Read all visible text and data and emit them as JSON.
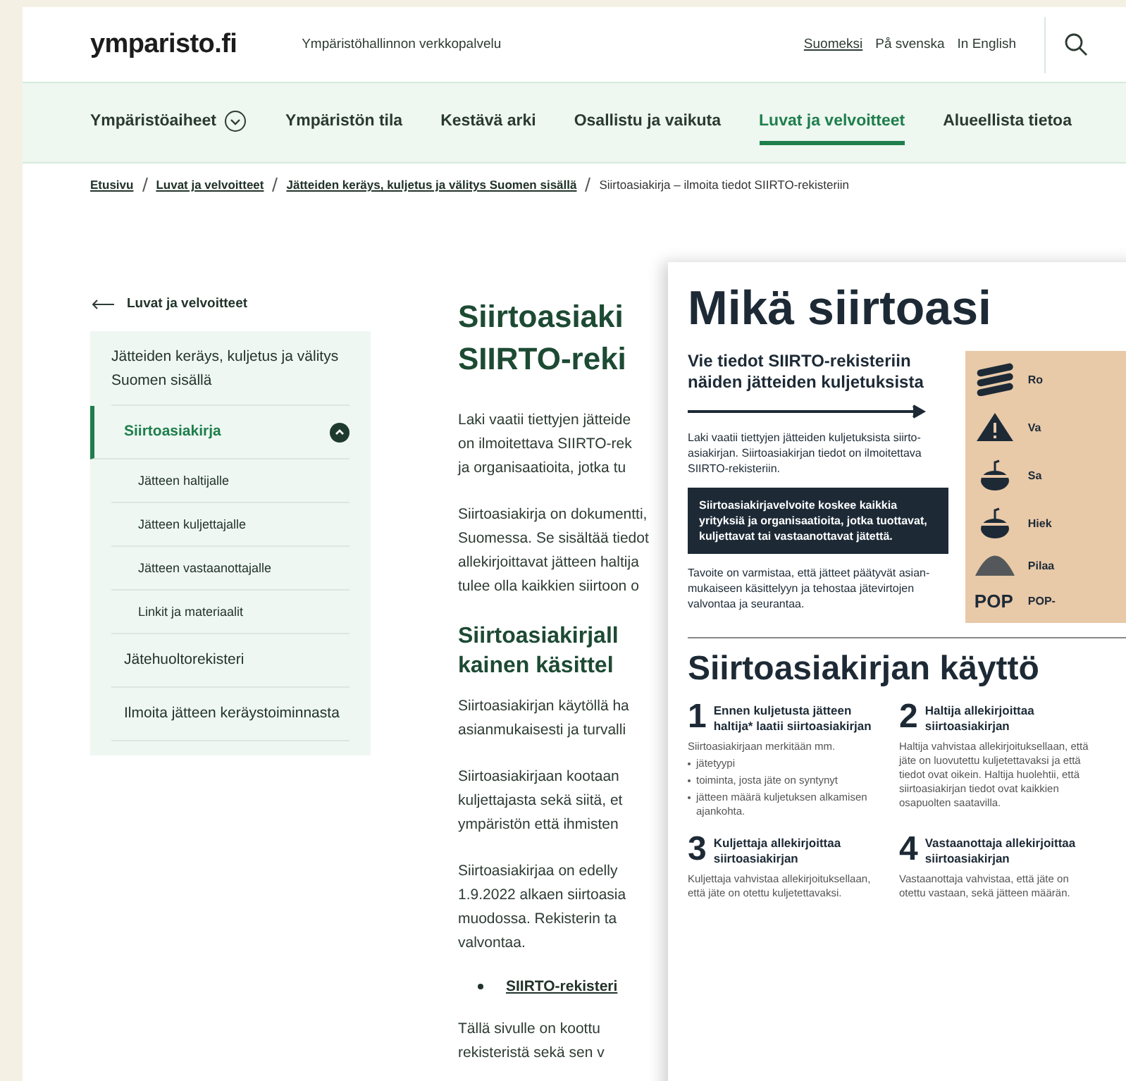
{
  "header": {
    "logo": "ymparisto.fi",
    "tagline": "Ympäristöhallinnon verkkopalvelu",
    "languages": [
      {
        "label": "Suomeksi",
        "selected": true
      },
      {
        "label": "På svenska",
        "selected": false
      },
      {
        "label": "In English",
        "selected": false
      }
    ]
  },
  "nav": [
    {
      "label": "Ympäristöaiheet",
      "selected": false,
      "kind": "dropdown"
    },
    {
      "label": "Ympäristön tila",
      "selected": false,
      "kind": "link"
    },
    {
      "label": "Kestävä arki",
      "selected": false,
      "kind": "link"
    },
    {
      "label": "Osallistu ja vaikuta",
      "selected": false,
      "kind": "link"
    },
    {
      "label": "Luvat ja velvoitteet",
      "selected": true,
      "kind": "link"
    },
    {
      "label": "Alueellista tietoa",
      "selected": false,
      "kind": "link"
    }
  ],
  "breadcrumb": [
    {
      "label": "Etusivu",
      "kind": "link"
    },
    {
      "label": "Luvat ja velvoitteet",
      "kind": "link"
    },
    {
      "label": "Jätteiden keräys, kuljetus ja välitys Suomen sisällä",
      "kind": "link"
    },
    {
      "label": "Siirtoasiakirja – ilmoita tiedot SIIRTO-rekisteriin",
      "kind": "current"
    }
  ],
  "sidebar": {
    "back_link": "Luvat ja velvoitteet",
    "section_title": "Jätteiden keräys, kuljetus ja välitys Suomen sisällä",
    "items": [
      {
        "label": "Siirtoasiakirja",
        "selected": true,
        "expanded": true,
        "children": [
          {
            "label": "Jätteen haltijalle",
            "selected": false
          },
          {
            "label": "Jätteen kuljettajalle",
            "selected": false
          },
          {
            "label": "Jätteen vastaanottajalle",
            "selected": false
          },
          {
            "label": "Linkit ja materiaalit",
            "selected": false
          }
        ]
      },
      {
        "label": "Jätehuoltorekisteri",
        "selected": false
      },
      {
        "label": "Ilmoita jätteen keräystoiminnasta",
        "selected": false
      }
    ]
  },
  "article": {
    "title": [
      "Siirtoasiaki",
      "SIIRTO-reki"
    ],
    "blocks": [
      {
        "kind": "paragraph",
        "lines": [
          "Laki vaatii tiettyjen jätteide",
          "on ilmoitettava SIIRTO-rek",
          "ja organisaatioita, jotka tu"
        ]
      },
      {
        "kind": "paragraph",
        "lines": [
          "Siirtoasiakirja on dokumentti,",
          "Suomessa. Se sisältää tiedot",
          "allekirjoittavat jätteen haltija",
          "tulee olla kaikkien siirtoon o"
        ]
      },
      {
        "kind": "heading",
        "lines": [
          "Siirtoasiakirjall",
          "kainen käsittel"
        ]
      },
      {
        "kind": "paragraph",
        "lines": [
          "Siirtoasiakirjan käytöllä ha",
          "asianmukaisesti ja turvalli"
        ]
      },
      {
        "kind": "paragraph",
        "lines": [
          "Siirtoasiakirjaan kootaan",
          "kuljettajasta sekä siitä, et",
          "ympäristön että ihmisten"
        ]
      },
      {
        "kind": "paragraph",
        "lines": [
          "Siirtoasiakirjaa on edelly",
          "1.9.2022 alkaen siirtoasia",
          "muodossa. Rekisterin ta",
          "valvontaa."
        ]
      },
      {
        "kind": "link",
        "lines": [
          "SIIRTO-rekisteri"
        ]
      },
      {
        "kind": "paragraph",
        "lines": [
          "Tällä sivulle on koottu",
          "rekisteristä sekä sen v"
        ]
      }
    ]
  },
  "poster": {
    "title": "Mikä siirtoasi",
    "subtitle": "Vie tiedot SIIRTO-rekisteriin näiden jätteiden kuljetuksista",
    "intro": "Laki vaatii tiettyjen jätteiden kuljetuksista siirto-asiakirjan. Siirtoasiakirjan tiedot on ilmoitettava SIIRTO-rekisteriin.",
    "highlight": "Siirtoasiakirjavelvoite koskee kaikkia yrityksiä ja organisaatioita, jotka tuottavat, kuljettavat tai vastaanottavat jätettä.",
    "goal": "Tavoite on varmistaa, että jätteet päätyvät asian-mukaiseen käsittelyyn ja tehostaa jätevirtojen valvontaa ja seurantaa.",
    "waste_types": [
      {
        "kind": "logs",
        "label": "Ro"
      },
      {
        "kind": "warning",
        "label": "Va"
      },
      {
        "kind": "pot",
        "label": "Sa"
      },
      {
        "kind": "pot",
        "label": "Hiek"
      },
      {
        "kind": "pile",
        "label": "Pilaa"
      },
      {
        "kind": "text",
        "icon_text": "POP",
        "label": "POP-"
      }
    ],
    "usage_title": "Siirtoasiakirjan käyttö",
    "steps": [
      {
        "number": "1",
        "title": "Ennen kuljetusta jätteen haltija* laatii siirtoasiakirjan",
        "text": "Siirtoasiakirjaan merkitään mm.",
        "bullets": [
          "jätetyypi",
          "toiminta, josta jäte on syntynyt",
          "jätteen määrä kuljetuksen alkamisen ajankohta."
        ]
      },
      {
        "number": "2",
        "title": "Haltija allekirjoittaa siirtoasiakirjan",
        "text": "Haltija vahvistaa allekirjoituksellaan, että jäte on luovutettu kuljetettavaksi ja että tiedot ovat oikein. Haltija huolehtii, että siirtoasiakirjan tiedot ovat kaikkien osapuolten saatavilla."
      },
      {
        "number": "3",
        "title": "Kuljettaja allekirjoittaa siirtoasiakirjan",
        "text": "Kuljettaja vahvistaa allekirjoituksellaan, että jäte on otettu kuljetettavaksi."
      },
      {
        "number": "4",
        "title": "Vastaanottaja allekirjoittaa siirtoasiakirjan",
        "text": "Vastaanottaja vahvistaa, että jäte on otettu vastaan, sekä jätteen määrän."
      }
    ]
  }
}
